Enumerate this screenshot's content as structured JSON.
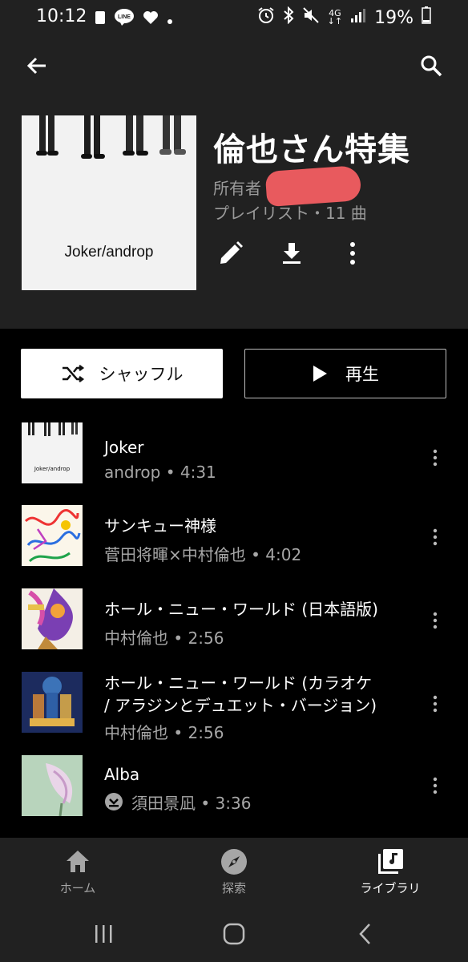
{
  "status_bar": {
    "time": "10:12",
    "battery": "19%",
    "network": "4G",
    "left_icons": [
      "image-icon",
      "line-icon",
      "heart-icon",
      "dot-icon"
    ],
    "right_icons": [
      "alarm-icon",
      "bluetooth-icon",
      "mute-icon",
      "network-4g-icon",
      "signal-icon",
      "battery-icon"
    ]
  },
  "header": {
    "back_icon": "arrow-back-icon",
    "search_icon": "search-icon",
    "cover_text": "Joker/androp",
    "title": "倫也さん特集",
    "owner_label": "所有者",
    "meta": "プレイリスト・11 曲",
    "actions": [
      "edit-icon",
      "download-icon",
      "more-icon"
    ]
  },
  "buttons": {
    "shuffle_label": "シャッフル",
    "play_label": "再生"
  },
  "tracks": [
    {
      "title": "Joker",
      "sub": "androp • 4:31",
      "downloaded": false
    },
    {
      "title": "サンキュー神様",
      "sub": "菅田将暉×中村倫也 • 4:02",
      "downloaded": false
    },
    {
      "title": "ホール・ニュー・ワールド (日本語版)",
      "sub": "中村倫也 • 2:56",
      "downloaded": false
    },
    {
      "title": "ホール・ニュー・ワールド (カラオケ",
      "title2": "/ アラジンとデュエット・バージョン)",
      "sub": "中村倫也 • 2:56",
      "downloaded": false
    },
    {
      "title": "Alba",
      "sub": "須田景凪 • 3:36",
      "downloaded": true
    }
  ],
  "nav": {
    "items": [
      {
        "label": "ホーム",
        "icon": "home-icon",
        "active": false
      },
      {
        "label": "探索",
        "icon": "explore-icon",
        "active": false
      },
      {
        "label": "ライブラリ",
        "icon": "library-icon",
        "active": true
      }
    ]
  },
  "colors": {
    "background": "#000000",
    "header_bg": "#212121",
    "subtext": "#a6a6a6",
    "redaction": "#e85a5e"
  }
}
